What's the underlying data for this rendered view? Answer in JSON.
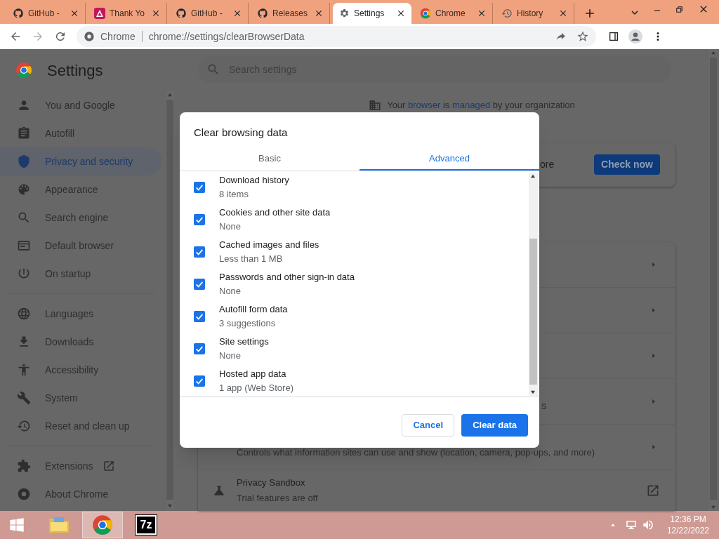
{
  "browser": {
    "tabs": [
      {
        "title": "GitHub -",
        "kind": "cat",
        "selected": false
      },
      {
        "title": "Thank Yo",
        "kind": "triangle",
        "selected": false
      },
      {
        "title": "GitHub -",
        "kind": "cat",
        "selected": false
      },
      {
        "title": "Releases",
        "kind": "cat",
        "selected": false
      },
      {
        "title": "Settings",
        "kind": "gear",
        "selected": true
      },
      {
        "title": "Chrome",
        "kind": "chrome",
        "selected": false
      },
      {
        "title": "History",
        "kind": "history",
        "selected": false
      }
    ],
    "address": {
      "site_label": "Chrome",
      "url": "chrome://settings/clearBrowserData"
    }
  },
  "settings_page": {
    "title": "Settings",
    "search": {
      "placeholder": "Search settings"
    },
    "sidebar": {
      "groups": [
        [
          {
            "label": "You and Google",
            "kind": "person",
            "selected": false
          },
          {
            "label": "Autofill",
            "kind": "clipboard",
            "selected": false
          },
          {
            "label": "Privacy and security",
            "kind": "shield",
            "selected": true
          },
          {
            "label": "Appearance",
            "kind": "palette",
            "selected": false
          },
          {
            "label": "Search engine",
            "kind": "search",
            "selected": false
          },
          {
            "label": "Default browser",
            "kind": "browser",
            "selected": false
          },
          {
            "label": "On startup",
            "kind": "power",
            "selected": false
          }
        ],
        [
          {
            "label": "Languages",
            "kind": "globe",
            "selected": false
          },
          {
            "label": "Downloads",
            "kind": "download",
            "selected": false
          },
          {
            "label": "Accessibility",
            "kind": "accessibility",
            "selected": false
          },
          {
            "label": "System",
            "kind": "wrench",
            "selected": false
          },
          {
            "label": "Reset and clean up",
            "kind": "history",
            "selected": false
          }
        ],
        [
          {
            "label": "Extensions",
            "kind": "puzzle",
            "selected": false,
            "external": true
          },
          {
            "label": "About Chrome",
            "kind": "ring",
            "selected": false
          }
        ]
      ]
    },
    "managed_notice": [
      {
        "text": "Your "
      },
      {
        "text": "browser",
        "link": true
      },
      {
        "text": " is "
      },
      {
        "text": "managed",
        "link": true
      },
      {
        "text": " by your organization"
      }
    ],
    "safety_check": {
      "text": "ore",
      "button": "Check now"
    },
    "rows": [
      {
        "kind": "arrow"
      },
      {
        "kind": "arrow"
      },
      {
        "kind": "arrow"
      },
      {
        "kind": "arrow",
        "text": "s"
      },
      {
        "kind": "arrow",
        "description": "Controls what information sites can use and show (location, camera, pop-ups, and more)"
      },
      {
        "kind": "external",
        "title": "Privacy Sandbox",
        "description": "Trial features are off"
      }
    ]
  },
  "dialog": {
    "title": "Clear browsing data",
    "tabs": [
      {
        "label": "Basic",
        "selected": false
      },
      {
        "label": "Advanced",
        "selected": true
      }
    ],
    "items": [
      {
        "label": "Download history",
        "detail": "8 items",
        "checked": true
      },
      {
        "label": "Cookies and other site data",
        "detail": "None",
        "checked": true
      },
      {
        "label": "Cached images and files",
        "detail": "Less than 1 MB",
        "checked": true
      },
      {
        "label": "Passwords and other sign-in data",
        "detail": "None",
        "checked": true
      },
      {
        "label": "Autofill form data",
        "detail": "3 suggestions",
        "checked": true
      },
      {
        "label": "Site settings",
        "detail": "None",
        "checked": true
      },
      {
        "label": "Hosted app data",
        "detail": "1 app (Web Store)",
        "checked": true
      }
    ],
    "buttons": [
      {
        "label": "Cancel",
        "kind": "secondary"
      },
      {
        "label": "Clear data",
        "kind": "primary"
      }
    ]
  },
  "taskbar": {
    "apps": [
      {
        "kind": "folder",
        "selected": false
      },
      {
        "kind": "chrome",
        "selected": true
      },
      {
        "kind": "archive",
        "label": "7z",
        "selected": false
      }
    ],
    "clock": {
      "time": "12:36 PM",
      "date": "12/22/2022"
    }
  }
}
